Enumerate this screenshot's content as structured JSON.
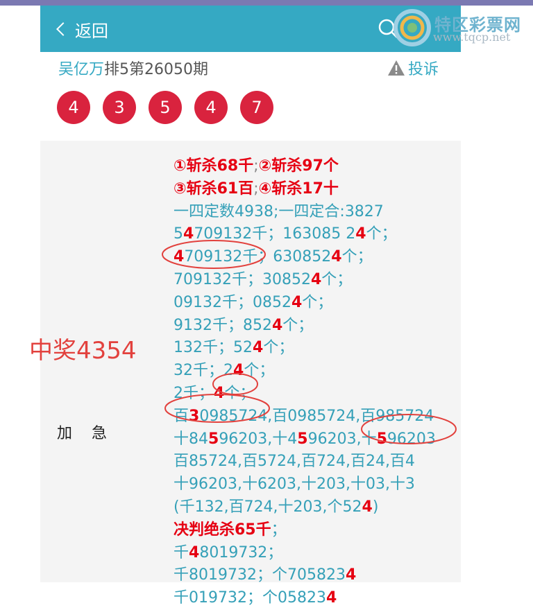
{
  "header": {
    "back_label": "返回",
    "logo_text": "特区彩票网",
    "logo_url": "www.tqcp.net"
  },
  "title": {
    "author": "吴亿万",
    "issue": "排5第26050期",
    "complaint_label": "投诉"
  },
  "balls": [
    "4",
    "3",
    "5",
    "4",
    "7"
  ],
  "sidebar": {
    "prize_text": "中奖4354",
    "urgent_label": "加急"
  },
  "content": {
    "lines": [
      [
        {
          "t": "①斩杀68千",
          "c": "r"
        },
        {
          "t": ";",
          "c": "g"
        },
        {
          "t": "②斩杀97个",
          "c": "r"
        }
      ],
      [
        {
          "t": "③斩杀61百",
          "c": "r"
        },
        {
          "t": ";",
          "c": "g"
        },
        {
          "t": "④斩杀17十",
          "c": "r"
        }
      ],
      [
        {
          "t": "一四定数4938;一四定合:3827",
          "c": ""
        }
      ],
      [
        {
          "t": "5",
          "c": ""
        },
        {
          "t": "4",
          "c": "rr"
        },
        {
          "t": "709132千；163085 2",
          "c": ""
        },
        {
          "t": "4",
          "c": "rr"
        },
        {
          "t": "个；",
          "c": ""
        }
      ],
      [
        {
          "t": "4",
          "c": "rr"
        },
        {
          "t": "709132千；630852",
          "c": ""
        },
        {
          "t": "4",
          "c": "rr"
        },
        {
          "t": "个；",
          "c": ""
        }
      ],
      [
        {
          "t": "709132千；30852",
          "c": ""
        },
        {
          "t": "4",
          "c": "rr"
        },
        {
          "t": "个；",
          "c": ""
        }
      ],
      [
        {
          "t": "09132千；0852",
          "c": ""
        },
        {
          "t": "4",
          "c": "rr"
        },
        {
          "t": "个；",
          "c": ""
        }
      ],
      [
        {
          "t": "9132千；852",
          "c": ""
        },
        {
          "t": "4",
          "c": "rr"
        },
        {
          "t": "个；",
          "c": ""
        }
      ],
      [
        {
          "t": "132千；52",
          "c": ""
        },
        {
          "t": "4",
          "c": "rr"
        },
        {
          "t": "个；",
          "c": ""
        }
      ],
      [
        {
          "t": "32千；2",
          "c": ""
        },
        {
          "t": "4",
          "c": "rr"
        },
        {
          "t": "个；",
          "c": ""
        }
      ],
      [
        {
          "t": "2千；",
          "c": ""
        },
        {
          "t": "4",
          "c": "rr"
        },
        {
          "t": "个；",
          "c": ""
        }
      ],
      [
        {
          "t": "百",
          "c": ""
        },
        {
          "t": "3",
          "c": "rr"
        },
        {
          "t": "0985724,百0985724,百985724",
          "c": ""
        }
      ],
      [
        {
          "t": "十84",
          "c": ""
        },
        {
          "t": "5",
          "c": "rr"
        },
        {
          "t": "96203,十4",
          "c": ""
        },
        {
          "t": "5",
          "c": "rr"
        },
        {
          "t": "96203,十",
          "c": ""
        },
        {
          "t": "5",
          "c": "rr"
        },
        {
          "t": "96203",
          "c": ""
        }
      ],
      [
        {
          "t": "百85724,百5724,百724,百24,百4",
          "c": ""
        }
      ],
      [
        {
          "t": "十96203,十6203,十203,十03,十3",
          "c": ""
        }
      ],
      [
        {
          "t": "(千132,百724,十203,个52",
          "c": ""
        },
        {
          "t": "4",
          "c": "rr"
        },
        {
          "t": ")",
          "c": ""
        }
      ],
      [
        {
          "t": "决判绝杀65千",
          "c": "r"
        },
        {
          "t": "；",
          "c": ""
        }
      ],
      [
        {
          "t": "千",
          "c": ""
        },
        {
          "t": "4",
          "c": "rr"
        },
        {
          "t": "8019732；",
          "c": ""
        }
      ],
      [
        {
          "t": "千8019732；个705823",
          "c": ""
        },
        {
          "t": "4",
          "c": "rr"
        }
      ],
      [
        {
          "t": "千019732；个05823",
          "c": ""
        },
        {
          "t": "4",
          "c": "rr"
        }
      ]
    ]
  },
  "colors": {
    "header_bg": "#35a9c3",
    "accent": "#35a9c3",
    "ball": "#d9233e",
    "highlight": "#e60012",
    "circle": "#e2413d"
  }
}
